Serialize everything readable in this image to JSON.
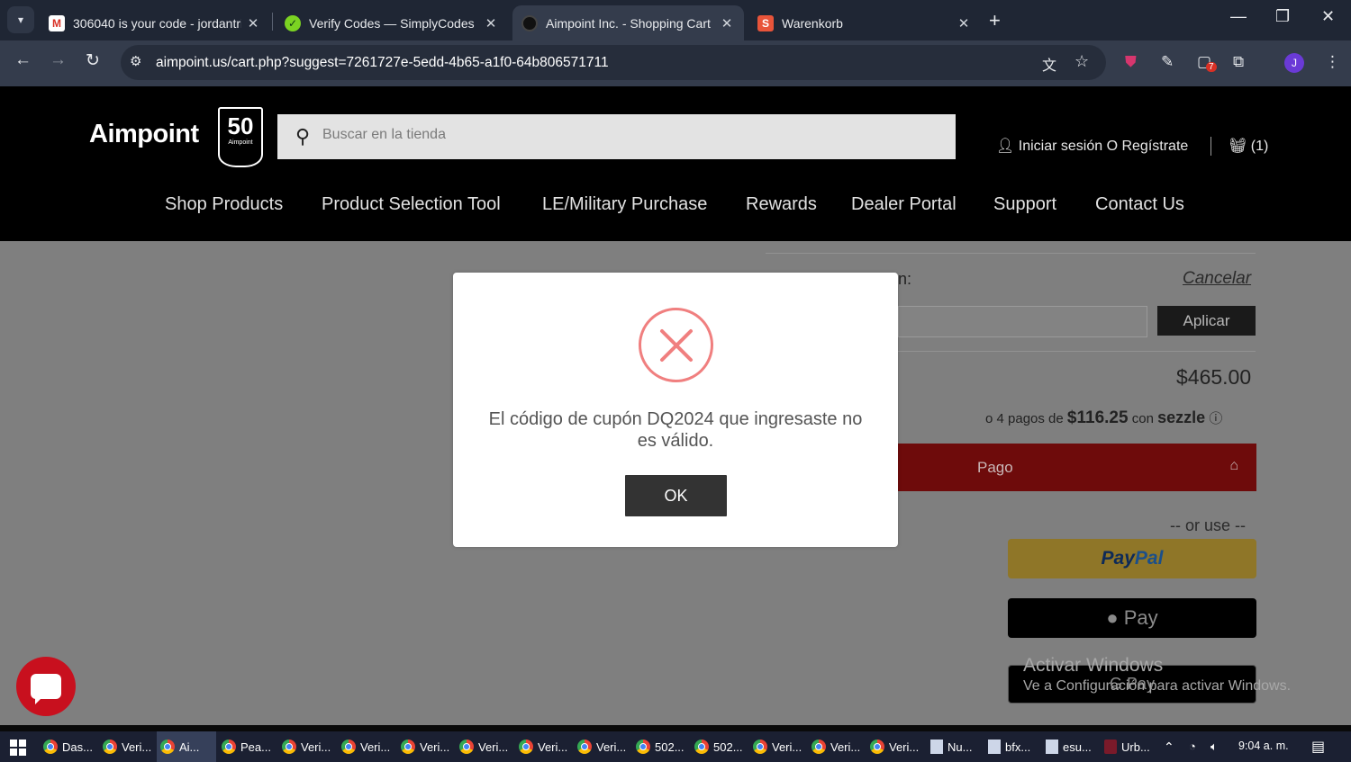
{
  "browser": {
    "tabs": [
      {
        "title": "306040 is your code - jordantri",
        "icon": "gmail-icon",
        "active": false
      },
      {
        "title": "Verify Codes — SimplyCodes",
        "icon": "simplycodes-icon",
        "active": false
      },
      {
        "title": "Aimpoint Inc. - Shopping Cart",
        "icon": "aimpoint-icon",
        "active": true
      },
      {
        "title": "Warenkorb",
        "icon": "shop-s-icon",
        "active": false
      }
    ],
    "url": "aimpoint.us/cart.php?suggest=7261727e-5edd-4b65-a1f0-64b806571711",
    "extension_badge": "7",
    "profile_initial": "J"
  },
  "site": {
    "logo": "Aimpoint",
    "anniversary_badge": "50",
    "anniversary_brand": "Aimpoint",
    "search_placeholder": "Buscar en la tienda",
    "login_text": "Iniciar sesión O Regístrate",
    "cart_count": "(1)",
    "nav": [
      "Shop Products",
      "Product Selection Tool",
      "LE/Military Purchase",
      "Rewards",
      "Dealer Portal",
      "Support",
      "Contact Us"
    ]
  },
  "cart": {
    "coupon_label_fragment": "n:",
    "cancel_link": "Cancelar",
    "apply_button": "Aplicar",
    "total": "$465.00",
    "sezzle_prefix": "o 4 pagos de",
    "sezzle_amount": "$116.25",
    "sezzle_con": "con",
    "sezzle_brand": "sezzle",
    "checkout_button": "Pago",
    "or_use": "-- or use --",
    "paypal_part1": "Pay",
    "paypal_part2": "Pal",
    "applepay_label": "Pay",
    "gpay_label": "Pay"
  },
  "modal": {
    "message": "El código de cupón DQ2024 que ingresaste no es válido.",
    "ok_button": "OK"
  },
  "watermark": {
    "line1": "Activar Windows",
    "line2": "Ve a Configuración para activar Windows."
  },
  "taskbar": {
    "items": [
      {
        "label": "Das...",
        "type": "chrome",
        "active": false
      },
      {
        "label": "Veri...",
        "type": "chrome",
        "active": false
      },
      {
        "label": "Ai...",
        "type": "chrome",
        "active": true
      },
      {
        "label": "Pea...",
        "type": "chrome",
        "active": false
      },
      {
        "label": "Veri...",
        "type": "chrome",
        "active": false
      },
      {
        "label": "Veri...",
        "type": "chrome",
        "active": false
      },
      {
        "label": "Veri...",
        "type": "chrome",
        "active": false
      },
      {
        "label": "Veri...",
        "type": "chrome",
        "active": false
      },
      {
        "label": "Veri...",
        "type": "chrome",
        "active": false
      },
      {
        "label": "Veri...",
        "type": "chrome",
        "active": false
      },
      {
        "label": "502...",
        "type": "chrome",
        "active": false
      },
      {
        "label": "502...",
        "type": "chrome",
        "active": false
      },
      {
        "label": "Veri...",
        "type": "chrome",
        "active": false
      },
      {
        "label": "Veri...",
        "type": "chrome",
        "active": false
      },
      {
        "label": "Veri...",
        "type": "chrome",
        "active": false
      },
      {
        "label": "Nu...",
        "type": "doc",
        "active": false
      },
      {
        "label": "bfx...",
        "type": "doc",
        "active": false
      },
      {
        "label": "esu...",
        "type": "doc",
        "active": false
      },
      {
        "label": "Urb...",
        "type": "app",
        "active": false
      }
    ],
    "time": "9:04 a. m."
  },
  "colors": {
    "accent_red": "#c8101e",
    "checkout_red": "#6e0b0b",
    "modal_error": "#f07f7f"
  }
}
